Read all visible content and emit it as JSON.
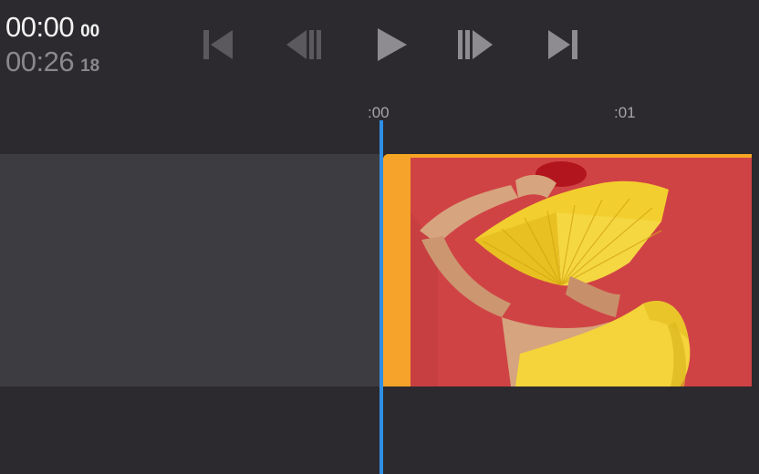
{
  "timecode": {
    "current_main": "00:00",
    "current_frames": "00",
    "duration_main": "00:26",
    "duration_frames": "18"
  },
  "transport": {
    "buttons": [
      "skip-to-start",
      "step-back",
      "play",
      "step-forward",
      "skip-to-end"
    ]
  },
  "ruler": {
    "labels": [
      ":00",
      ":01"
    ]
  },
  "colors": {
    "background": "#2c2a2e",
    "track_empty": "#3d3c40",
    "clip_accent": "#f5a623",
    "playhead": "#2f8fe6",
    "thumb_wall": "#d9484a",
    "thumb_fan": "#f2cf2e",
    "thumb_dress": "#f4d43a"
  }
}
